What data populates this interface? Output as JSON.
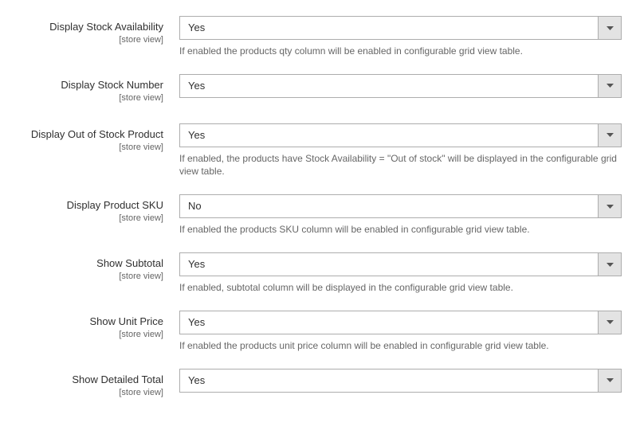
{
  "scope_text": "[store view]",
  "fields": [
    {
      "label": "Display Stock Availability",
      "value": "Yes",
      "note": "If enabled the products qty column will be enabled in configurable grid view table."
    },
    {
      "label": "Display Stock Number",
      "value": "Yes",
      "note": ""
    },
    {
      "label": "Display Out of Stock Product",
      "value": "Yes",
      "note": "If enabled, the products have Stock Availability = \"Out of stock\" will be displayed in the configurable grid view table."
    },
    {
      "label": "Display Product SKU",
      "value": "No",
      "note": "If enabled the products SKU column will be enabled in configurable grid view table."
    },
    {
      "label": "Show Subtotal",
      "value": "Yes",
      "note": "If enabled, subtotal column will be displayed in the configurable grid view table."
    },
    {
      "label": "Show Unit Price",
      "value": "Yes",
      "note": "If enabled the products unit price column will be enabled in configurable grid view table."
    },
    {
      "label": "Show Detailed Total",
      "value": "Yes",
      "note": ""
    }
  ]
}
